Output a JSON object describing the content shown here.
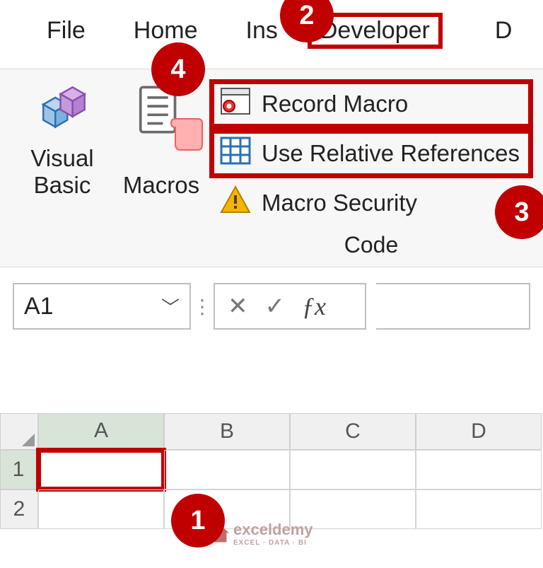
{
  "tabs": {
    "file": "File",
    "home": "Home",
    "insert": "Ins",
    "developer": "Developer",
    "next": "D"
  },
  "ribbon": {
    "visual_basic": "Visual\nBasic",
    "macros": "Macros",
    "record_macro": "Record Macro",
    "relative_refs": "Use Relative References",
    "macro_security": "Macro Security",
    "group_label": "Code"
  },
  "formula_bar": {
    "name_box": "A1",
    "fx_symbol": "ƒx"
  },
  "grid": {
    "col_headers": [
      "A",
      "B",
      "C",
      "D"
    ],
    "row_headers": [
      "1",
      "2"
    ],
    "selected_cell": "A1"
  },
  "callouts": {
    "c1": "1",
    "c2": "2",
    "c3": "3",
    "c4": "4"
  },
  "watermark": {
    "brand": "exceldemy",
    "tag": "EXCEL · DATA · BI"
  },
  "colors": {
    "highlight": "#c00000",
    "sel_green": "#1e7a3a"
  }
}
